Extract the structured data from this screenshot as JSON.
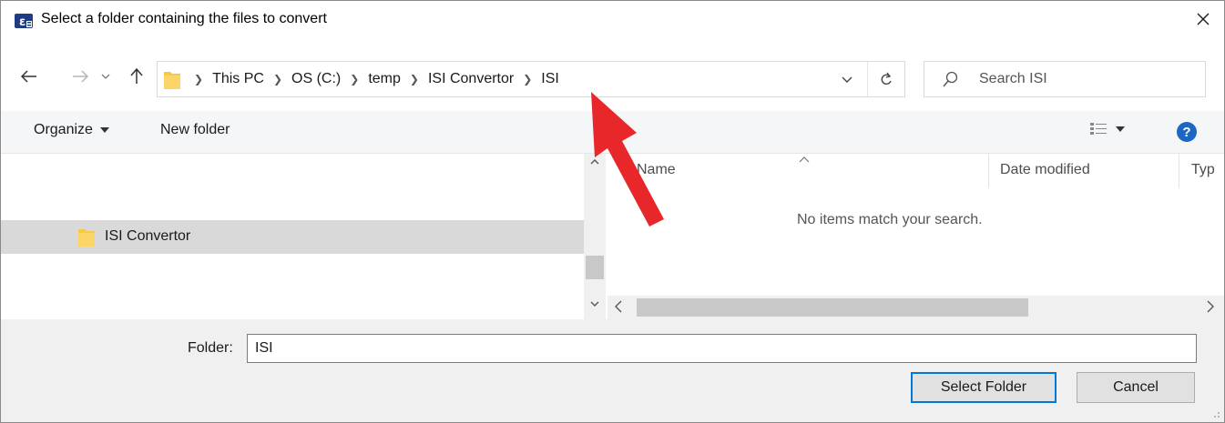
{
  "window": {
    "title": "Select a folder containing the files to convert",
    "app_icon": "app-e-icon",
    "close_icon": "close-icon"
  },
  "nav": {
    "back_icon": "arrow-left-icon",
    "forward_icon": "arrow-right-icon",
    "recent_icon": "chevron-down-icon",
    "up_icon": "arrow-up-icon",
    "breadcrumbs": [
      "This PC",
      "OS (C:)",
      "temp",
      "ISI Convertor",
      "ISI"
    ],
    "search_placeholder": "Search ISI"
  },
  "toolbar": {
    "organize_label": "Organize",
    "new_folder_label": "New folder",
    "help_label": "?"
  },
  "navpane": {
    "selected_item": "ISI Convertor"
  },
  "filelist": {
    "columns": [
      "Name",
      "Date modified",
      "Typ"
    ],
    "empty_message": "No items match your search."
  },
  "footer": {
    "folder_label": "Folder:",
    "folder_value": "ISI",
    "select_button": "Select Folder",
    "cancel_button": "Cancel"
  },
  "colors": {
    "accent": "#0078d7",
    "help": "#1c66c4",
    "annotation_arrow": "#e8272a",
    "folder": "#f7c948"
  }
}
